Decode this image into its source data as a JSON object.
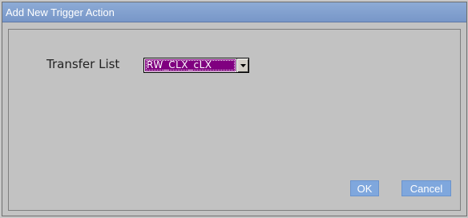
{
  "dialog": {
    "title": "Add New Trigger Action"
  },
  "form": {
    "transfer_list_label": "Transfer List",
    "transfer_list_value": "RW_CLX_cLX"
  },
  "buttons": {
    "ok_label": "OK",
    "cancel_label": "Cancel"
  },
  "colors": {
    "titlebar": "#7f9fd0",
    "selection": "#800080",
    "button": "#7fa7dd"
  },
  "icons": {
    "dropdown": "chevron-down-icon"
  }
}
